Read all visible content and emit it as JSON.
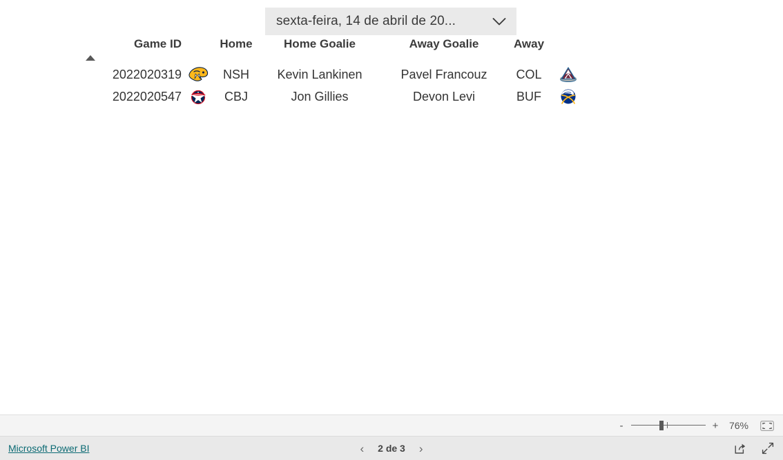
{
  "slicer": {
    "name": "date-slicer",
    "value": "sexta-feira, 14 de abril de 20...",
    "chevron_icon": "chevron-down-icon"
  },
  "table": {
    "sort": {
      "column": "Game ID",
      "direction": "ascending",
      "icon": "sort-ascending-icon"
    },
    "columns": [
      {
        "key": "game_id",
        "label": "Game ID"
      },
      {
        "key": "home_logo",
        "label": ""
      },
      {
        "key": "home",
        "label": "Home"
      },
      {
        "key": "home_goalie",
        "label": "Home Goalie"
      },
      {
        "key": "away_goalie",
        "label": "Away Goalie"
      },
      {
        "key": "away",
        "label": "Away"
      },
      {
        "key": "away_logo",
        "label": ""
      }
    ],
    "rows": [
      {
        "game_id": "2022020319",
        "home_logo": "nashville-predators-logo",
        "home": "NSH",
        "home_goalie": "Kevin Lankinen",
        "away_goalie": "Pavel Francouz",
        "away": "COL",
        "away_logo": "colorado-avalanche-logo"
      },
      {
        "game_id": "2022020547",
        "home_logo": "columbus-blue-jackets-logo",
        "home": "CBJ",
        "home_goalie": "Jon Gillies",
        "away_goalie": "Devon Levi",
        "away": "BUF",
        "away_logo": "buffalo-sabres-logo"
      }
    ]
  },
  "zoom_bar": {
    "minus_label": "-",
    "plus_label": "+",
    "level": "76%",
    "fit_icon": "fit-to-page-icon"
  },
  "footer": {
    "powerbi_link": "Microsoft Power BI",
    "prev_label": "‹",
    "page_label": "2 de 3",
    "next_label": "›",
    "share_icon": "share-icon",
    "fullscreen_icon": "fullscreen-icon"
  },
  "colors": {
    "link": "#0b6a73",
    "header_text": "#3b3b3b",
    "body_text": "#333333",
    "slicer_bg": "#eaeaea",
    "zoom_bar_bg": "#f4f4f4",
    "footer_bg": "#e9e9e9"
  }
}
